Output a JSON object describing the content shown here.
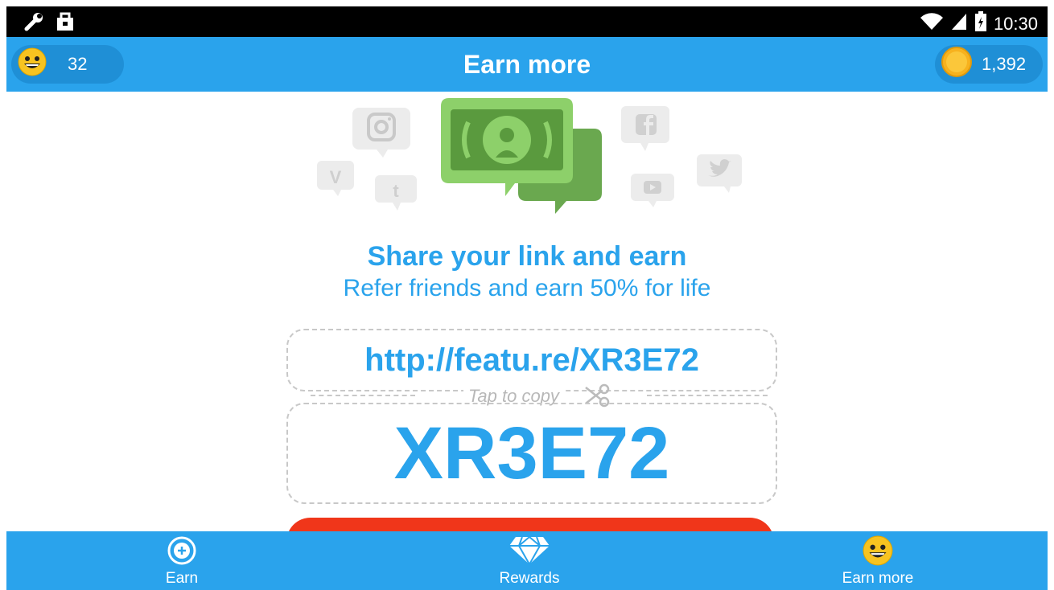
{
  "status_bar": {
    "time": "10:30",
    "icons": [
      "wrench-icon",
      "bag-icon",
      "wifi-icon",
      "signal-icon",
      "battery-icon"
    ]
  },
  "app_bar": {
    "title": "Earn more",
    "left_count": "32",
    "right_count": "1,392"
  },
  "hero_icons": [
    "instagram-icon",
    "vine-icon",
    "tumblr-icon",
    "facebook-icon",
    "youtube-icon",
    "twitter-icon",
    "money-chat-icon"
  ],
  "main": {
    "headline": "Share your link and earn",
    "subline": "Refer friends and earn 50% for life",
    "link": "http://featu.re/XR3E72",
    "copy_hint": "Tap to copy",
    "code": "XR3E72"
  },
  "bottom_nav": [
    {
      "label": "Earn",
      "icon": "plus-circle-icon"
    },
    {
      "label": "Rewards",
      "icon": "diamond-icon"
    },
    {
      "label": "Earn more",
      "icon": "smiley-icon"
    }
  ],
  "colors": {
    "accent": "#2aa3ec",
    "status_bar": "#000000",
    "cta": "#f0361a",
    "money_green": "#8dd06a",
    "money_dark": "#6aa84f",
    "coin": "#f7b21e"
  }
}
